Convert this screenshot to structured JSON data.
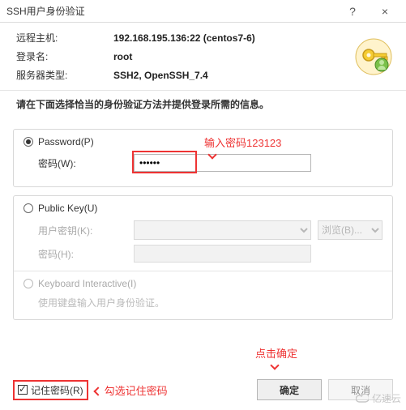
{
  "titlebar": {
    "title": "SSH用户身份验证",
    "help": "?",
    "close": "×"
  },
  "info": {
    "host_label": "远程主机:",
    "host_value": "192.168.195.136:22 (centos7-6)",
    "user_label": "登录名:",
    "user_value": "root",
    "type_label": "服务器类型:",
    "type_value": "SSH2, OpenSSH_7.4"
  },
  "instruction": "请在下面选择恰当的身份验证方法并提供登录所需的信息。",
  "methods": {
    "password": {
      "radio_label": "Password(P)",
      "pwd_label": "密码(W):",
      "pwd_value": "••••••"
    },
    "publickey": {
      "radio_label": "Public Key(U)",
      "userkey_label": "用户密钥(K):",
      "browse_label": "浏览(B)...",
      "pass_label": "密码(H):"
    },
    "keyboard": {
      "radio_label": "Keyboard Interactive(I)",
      "description": "使用键盘输入用户身份验证。"
    }
  },
  "remember": {
    "label": "记住密码(R)"
  },
  "buttons": {
    "ok": "确定",
    "cancel": "取消"
  },
  "annotations": {
    "enter_pwd": "输入密码123123",
    "check_remember": "勾选记住密码",
    "click_ok": "点击确定"
  },
  "watermark": "亿速云"
}
